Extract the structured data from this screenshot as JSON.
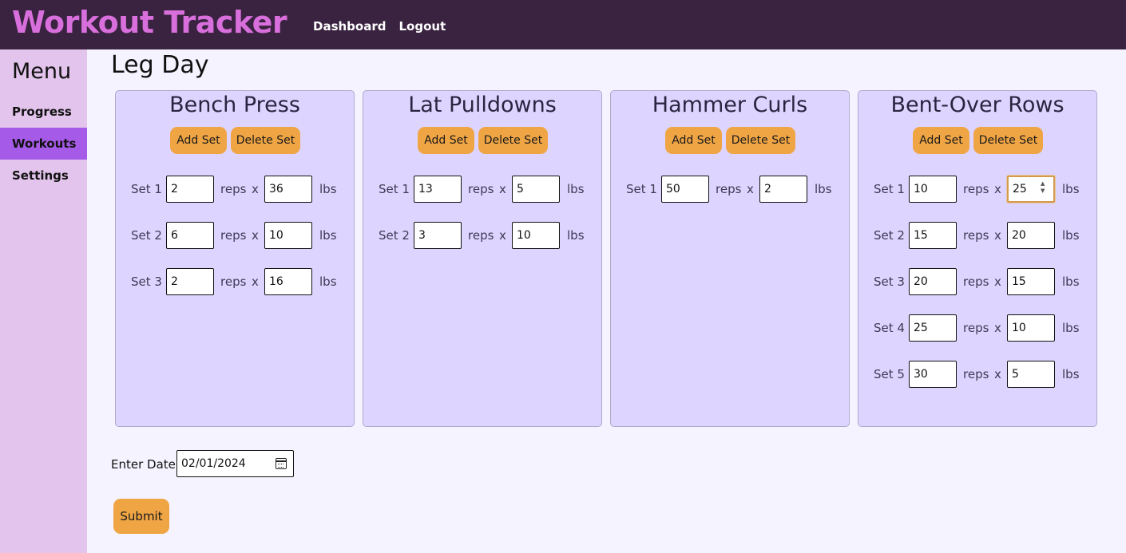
{
  "app": {
    "title": "Workout Tracker"
  },
  "nav": {
    "dashboard": "Dashboard",
    "logout": "Logout"
  },
  "sidebar": {
    "title": "Menu",
    "items": [
      {
        "label": "Progress",
        "active": false
      },
      {
        "label": "Workouts",
        "active": true
      },
      {
        "label": "Settings",
        "active": false
      }
    ]
  },
  "page": {
    "title": "Leg Day"
  },
  "labels": {
    "add_set": "Add Set",
    "delete_set": "Delete Set",
    "reps": "reps",
    "x": "x",
    "lbs": "lbs"
  },
  "exercises": [
    {
      "name": "Bench Press",
      "sets": [
        {
          "label": "Set 1",
          "reps": "2",
          "weight": "36"
        },
        {
          "label": "Set 2",
          "reps": "6",
          "weight": "10"
        },
        {
          "label": "Set 3",
          "reps": "2",
          "weight": "16"
        }
      ]
    },
    {
      "name": "Lat Pulldowns",
      "sets": [
        {
          "label": "Set 1",
          "reps": "13",
          "weight": "5"
        },
        {
          "label": "Set 2",
          "reps": "3",
          "weight": "10"
        }
      ]
    },
    {
      "name": "Hammer Curls",
      "sets": [
        {
          "label": "Set 1",
          "reps": "50",
          "weight": "2"
        }
      ]
    },
    {
      "name": "Bent-Over Rows",
      "sets": [
        {
          "label": "Set 1",
          "reps": "10",
          "weight": "25"
        },
        {
          "label": "Set 2",
          "reps": "15",
          "weight": "20"
        },
        {
          "label": "Set 3",
          "reps": "20",
          "weight": "15"
        },
        {
          "label": "Set 4",
          "reps": "25",
          "weight": "10"
        },
        {
          "label": "Set 5",
          "reps": "30",
          "weight": "5"
        }
      ]
    }
  ],
  "date": {
    "label": "Enter Date:",
    "value": "02/01/2024"
  },
  "submit": {
    "label": "Submit"
  },
  "colors": {
    "header": "#3a2340",
    "brand": "#d86fdc",
    "sidebar": "#e3c4ec",
    "active_item": "#a65ae8",
    "card": "#ddd5ff",
    "button": "#f0a545",
    "background": "#f5f3ff"
  }
}
